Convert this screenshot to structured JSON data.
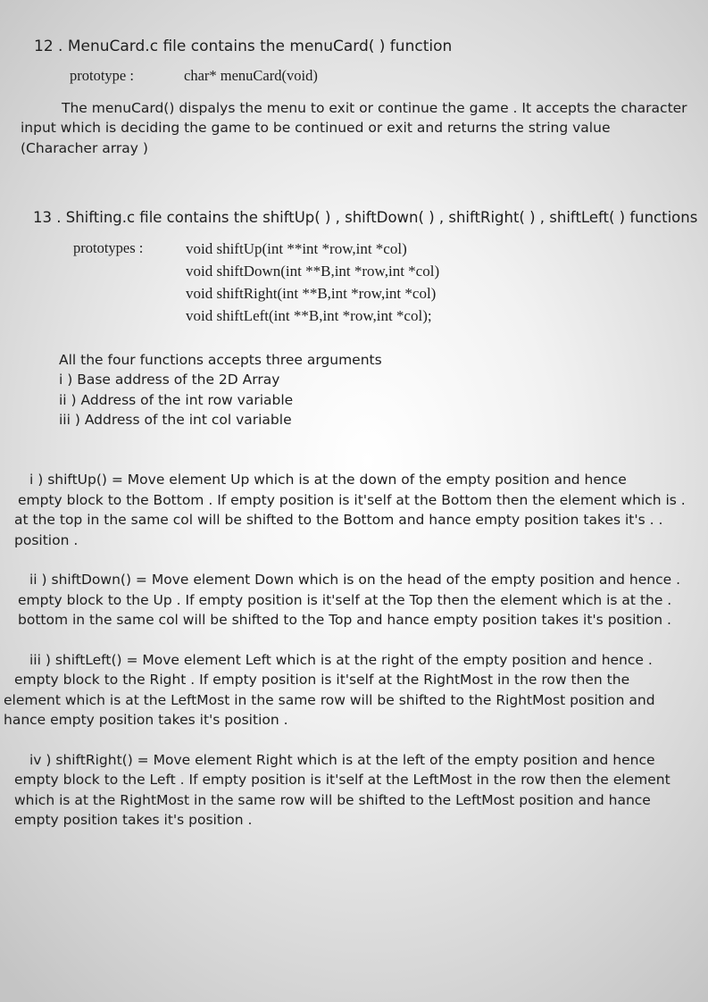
{
  "section12": {
    "heading": "12 . MenuCard.c file contains the menuCard( ) function",
    "prototype_label": "prototype   :",
    "prototype": "char* menuCard(void)",
    "description": [
      "The menuCard() dispalys the menu to exit or continue the game . It accepts the character",
      "input which is deciding the game to be continued or exit  and returns the string value",
      "(Characher  array )"
    ]
  },
  "section13": {
    "heading": "13 . Shifting.c file contains the shiftUp( ) , shiftDown( ) , shiftRight( ) , shiftLeft( ) functions",
    "prototypes_label": "prototypes  :",
    "prototypes": [
      "void shiftUp(int **int *row,int *col)",
      "void shiftDown(int **B,int *row,int *col)",
      "void shiftRight(int **B,int *row,int *col)",
      "void shiftLeft(int **B,int *row,int *col);"
    ],
    "arguments": [
      "All the four functions accepts three arguments",
      "i )   Base address of the 2D  Array",
      "ii )  Address of the int row variable",
      "iii ) Address of the int col variable"
    ]
  },
  "functions": [
    {
      "lines": [
        "i ) shiftUp()     =       Move element Up which is at the down of the empty position and hence",
        "empty block to the Bottom  . If empty  position is it'self at the Bottom then the element which is .",
        "at the top in the same col will be shifted to the Bottom and hance empty position takes it's .          .",
        "position ."
      ]
    },
    {
      "lines": [
        "ii ) shiftDown()  =  Move element Down which is on the head of the empty position and hence .",
        "empty block to the Up  . If empty position is it'self at the Top then the element which is at the .",
        "bottom in the same col will be shifted to the Top and hance empty position takes it's position ."
      ]
    },
    {
      "lines": [
        "iii ) shiftLeft()    =    Move element Left which is at the right of the empty position and hence .",
        "empty block to the Right  . If empty position is it'self at the RightMost in the row then the",
        "element     which is at the LeftMost in the same row will be shifted to the RightMost position and",
        "hance              empty position takes it's position ."
      ]
    },
    {
      "lines": [
        "iv ) shiftRight()   =  Move element Right which is at the left of the empty position and hence",
        "empty block to the Left . If empty position is it'self at the LeftMost in the row then the element",
        "which is at the RightMost in the same row will be shifted to the LeftMost position and hance",
        "empty position takes it's position ."
      ]
    }
  ]
}
